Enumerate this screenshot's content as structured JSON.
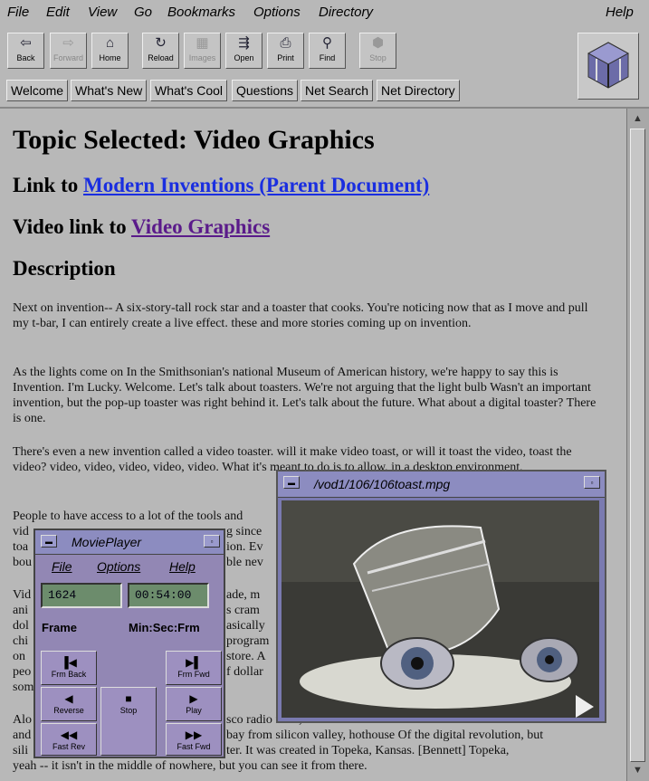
{
  "menubar": {
    "file": "File",
    "edit": "Edit",
    "view": "View",
    "go": "Go",
    "bookmarks": "Bookmarks",
    "options": "Options",
    "directory": "Directory",
    "help": "Help"
  },
  "toolbar": {
    "back": "Back",
    "forward": "Forward",
    "home": "Home",
    "reload": "Reload",
    "images": "Images",
    "open": "Open",
    "print": "Print",
    "find": "Find",
    "stop": "Stop"
  },
  "directory": {
    "welcome": "Welcome",
    "whats_new": "What's New",
    "whats_cool": "What's Cool",
    "questions": "Questions",
    "net_search": "Net Search",
    "net_directory": "Net Directory"
  },
  "page": {
    "title": "Topic Selected: Video Graphics",
    "link_prefix": "Link to ",
    "link_text": "Modern Inventions (Parent Document)",
    "video_prefix": "Video link to ",
    "video_link": "Video Graphics",
    "description": "Description",
    "p1": "Next on invention-- A six-story-tall rock star and a toaster that cooks. You're noticing now that as I move and pull my t-bar, I can entirely create a live effect. these and more stories coming up on invention.",
    "p2": "As the lights come on In the Smithsonian's national Museum of American history, we're happy to say this is Invention. I'm Lucky. Welcome. Let's talk about toasters. We're not arguing that the light bulb Wasn't an important invention, but the pop-up toaster was right behind it. Let's talk about the future. What about a digital toaster? There is one.",
    "p3": "There's even a new invention called a video toaster. will it make video toast, or will it toast the video, toast the video? video, video, video, video, video. What it's meant to do is to allow, in a desktop environment,",
    "p4_l1": "People to have access to a lot of the tools and",
    "p4_l2a": "vid",
    "p4_l2b": "g since",
    "p4_l3a": "toa",
    "p4_l3b": "ion. Ev",
    "p4_l4a": "bou",
    "p4_l4b": "ble nev",
    "p5_l1a": "Vid",
    "p5_l1b": "ade, m",
    "p5_l2a": "ani",
    "p5_l2b": "s cram",
    "p5_l3a": "dol",
    "p5_l3b": "asically",
    "p5_l4a": "chi",
    "p5_l4b": "program",
    "p5_l5a": "on",
    "p5_l5b": "store. A",
    "p5_l6a": "peo",
    "p5_l6b": "f dollar",
    "p5_l7a": "som",
    "p6_l1a": "Alo",
    "p6_l1b": "sco radio field, used the toaster to make his electric videos flash",
    "p6_l2a": "and",
    "p6_l2b": "bay from silicon valley, hothouse Of the digital revolution, but",
    "p6_l3a": "sili",
    "p6_l3b": "ter. It was created in Topeka, Kansas. [Bennett] Topeka,",
    "p6_l4": "yeah -- it isn't in the middle of nowhere, but you can see it from there."
  },
  "video_window": {
    "title": "/vod1/106/106toast.mpg"
  },
  "movie_player": {
    "title": "MoviePlayer",
    "menu_file": "File",
    "menu_options": "Options",
    "menu_help": "Help",
    "frame_value": "1624",
    "time_value": "00:54:00",
    "frame_label": "Frame",
    "time_label": "Min:Sec:Frm",
    "frm_back": "Frm Back",
    "frm_fwd": "Frm Fwd",
    "reverse": "Reverse",
    "stop": "Stop",
    "play": "Play",
    "fast_rev": "Fast Rev",
    "fast_fwd": "Fast Fwd"
  },
  "colors": {
    "link": "#1a2ee0",
    "visited": "#5a1a8a",
    "background": "#b8b8b8",
    "window_title": "#8c8cc0",
    "player_body": "#9287b4"
  }
}
